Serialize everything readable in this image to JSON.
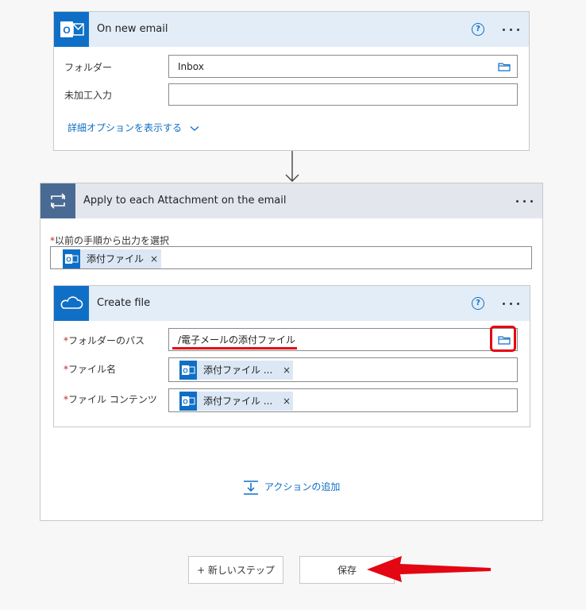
{
  "trigger": {
    "title": "On new email",
    "help_icon": "?",
    "folder_label": "フォルダー",
    "folder_value": "Inbox",
    "unprocessed_label": "未加工入力",
    "unprocessed_value": "",
    "advanced_link": "詳細オプションを表示する"
  },
  "loop": {
    "title": "Apply to each Attachment on the email",
    "select_label": "以前の手順から出力を選択",
    "required_mark": "*",
    "token_label": "添付ファイル",
    "token_remove": "×"
  },
  "create_file": {
    "title": "Create file",
    "help_icon": "?",
    "folder_path_label": "フォルダーのパス",
    "folder_path_value": "/電子メールの添付ファイル",
    "file_name_label": "ファイル名",
    "file_name_token": "添付ファイル ...",
    "file_content_label": "ファイル コンテンツ",
    "file_content_token": "添付ファイル ...",
    "token_remove": "×"
  },
  "add_action_label": "アクションの追加",
  "footer": {
    "new_step_label": "+ 新しいステップ",
    "save_label": "保存"
  },
  "colors": {
    "brand_blue": "#0f6fc6",
    "loop_header": "#496b93",
    "highlight_red": "#e30613"
  }
}
